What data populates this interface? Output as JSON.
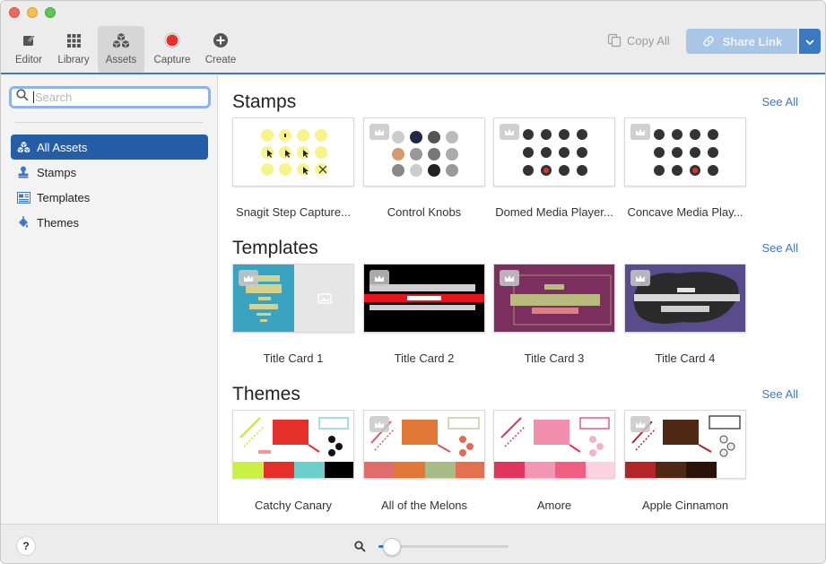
{
  "window": {
    "controls": [
      "close",
      "minimize",
      "zoom"
    ]
  },
  "toolbar": {
    "tools": [
      {
        "label": "Editor",
        "icon": "editor-icon"
      },
      {
        "label": "Library",
        "icon": "grid-icon"
      },
      {
        "label": "Assets",
        "icon": "assets-icon",
        "active": true
      },
      {
        "label": "Capture",
        "icon": "record-icon"
      },
      {
        "label": "Create",
        "icon": "plus-circle-icon"
      }
    ],
    "copy_all": "Copy All",
    "share_link": "Share Link"
  },
  "sidebar": {
    "search_placeholder": "Search",
    "items": [
      {
        "label": "All Assets",
        "icon": "assets-icon",
        "selected": true
      },
      {
        "label": "Stamps",
        "icon": "stamp-icon"
      },
      {
        "label": "Templates",
        "icon": "template-icon"
      },
      {
        "label": "Themes",
        "icon": "paint-bucket-icon"
      }
    ]
  },
  "main": {
    "sections": [
      {
        "title": "Stamps",
        "see_all": "See All",
        "items": [
          "Snagit Step Capture...",
          "Control Knobs",
          "Domed Media Player...",
          "Concave Media Play..."
        ]
      },
      {
        "title": "Templates",
        "see_all": "See All",
        "items": [
          "Title Card 1",
          "Title Card 2",
          "Title Card 3",
          "Title Card 4"
        ]
      },
      {
        "title": "Themes",
        "see_all": "See All",
        "items": [
          "Catchy Canary",
          "All of the Melons",
          "Amore",
          "Apple Cinnamon"
        ]
      }
    ]
  },
  "footer": {
    "help": "?",
    "zoom_level": 0.1
  },
  "colors": {
    "accent": "#3b79c2",
    "selected": "#255da6",
    "record": "#e0332d"
  }
}
